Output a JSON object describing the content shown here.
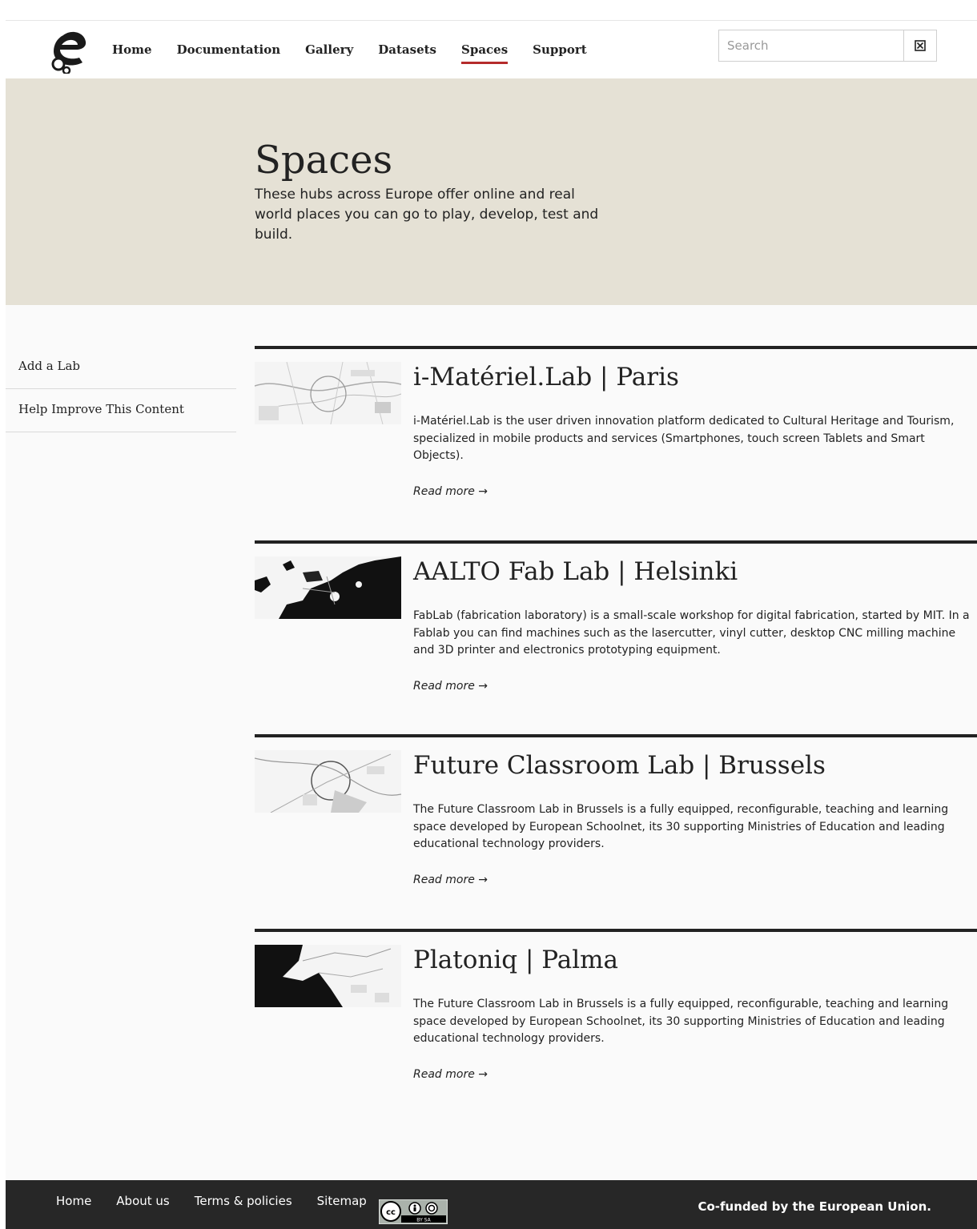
{
  "header": {
    "nav": [
      {
        "label": "Home"
      },
      {
        "label": "Documentation"
      },
      {
        "label": "Gallery"
      },
      {
        "label": "Datasets"
      },
      {
        "label": "Spaces",
        "active": true
      },
      {
        "label": "Support"
      }
    ],
    "search": {
      "placeholder": "Search",
      "clear_icon": "close-box-icon"
    }
  },
  "hero": {
    "title": "Spaces",
    "subtitle": "These hubs across Europe offer online and real world places you can go to play, develop, test and build."
  },
  "sidebar": {
    "items": [
      {
        "label": "Add a Lab"
      },
      {
        "label": "Help Improve This Content"
      }
    ]
  },
  "labs": [
    {
      "title": "i-Matériel.Lab | Paris",
      "description": "i-Matériel.Lab is the user driven innovation platform dedicated to Cultural Heritage and Tourism, specialized in mobile products and services (Smartphones, touch screen Tablets and Smart Objects).",
      "read_more": "Read more →",
      "thumb_icon": "paris-map-thumbnail"
    },
    {
      "title": "AALTO Fab Lab | Helsinki",
      "description": "FabLab (fabrication laboratory) is a small-scale workshop for digital fabrication, started by MIT. In a Fablab you can find machines such as the lasercutter, vinyl cutter, desktop CNC milling machine and 3D printer and electronics prototyping equipment.",
      "read_more": "Read more →",
      "thumb_icon": "helsinki-map-thumbnail"
    },
    {
      "title": "Future Classroom Lab | Brussels",
      "description": "The Future Classroom Lab in Brussels is a fully equipped, reconfigurable, teaching and learning space developed by European Schoolnet, its 30 supporting Ministries of Education and leading educational technology providers.",
      "read_more": "Read more →",
      "thumb_icon": "brussels-map-thumbnail"
    },
    {
      "title": "Platoniq | Palma",
      "description": "The Future Classroom Lab in Brussels is a fully equipped, reconfigurable, teaching and learning space developed by European Schoolnet, its 30 supporting Ministries of Education and leading educational technology providers.",
      "read_more": "Read more →",
      "thumb_icon": "palma-map-thumbnail"
    }
  ],
  "footer": {
    "links": [
      {
        "label": "Home"
      },
      {
        "label": "About us"
      },
      {
        "label": "Terms & policies"
      },
      {
        "label": "Sitemap"
      }
    ],
    "license_badge": {
      "icon": "cc-by-sa-icon",
      "text": "BY SA"
    },
    "cofunded": "Co-funded by the European Union."
  },
  "colors": {
    "hero_bg": "#e5e1d5",
    "nav_active": "#b52b2b",
    "footer_bg": "#272727",
    "divider": "#222222"
  }
}
